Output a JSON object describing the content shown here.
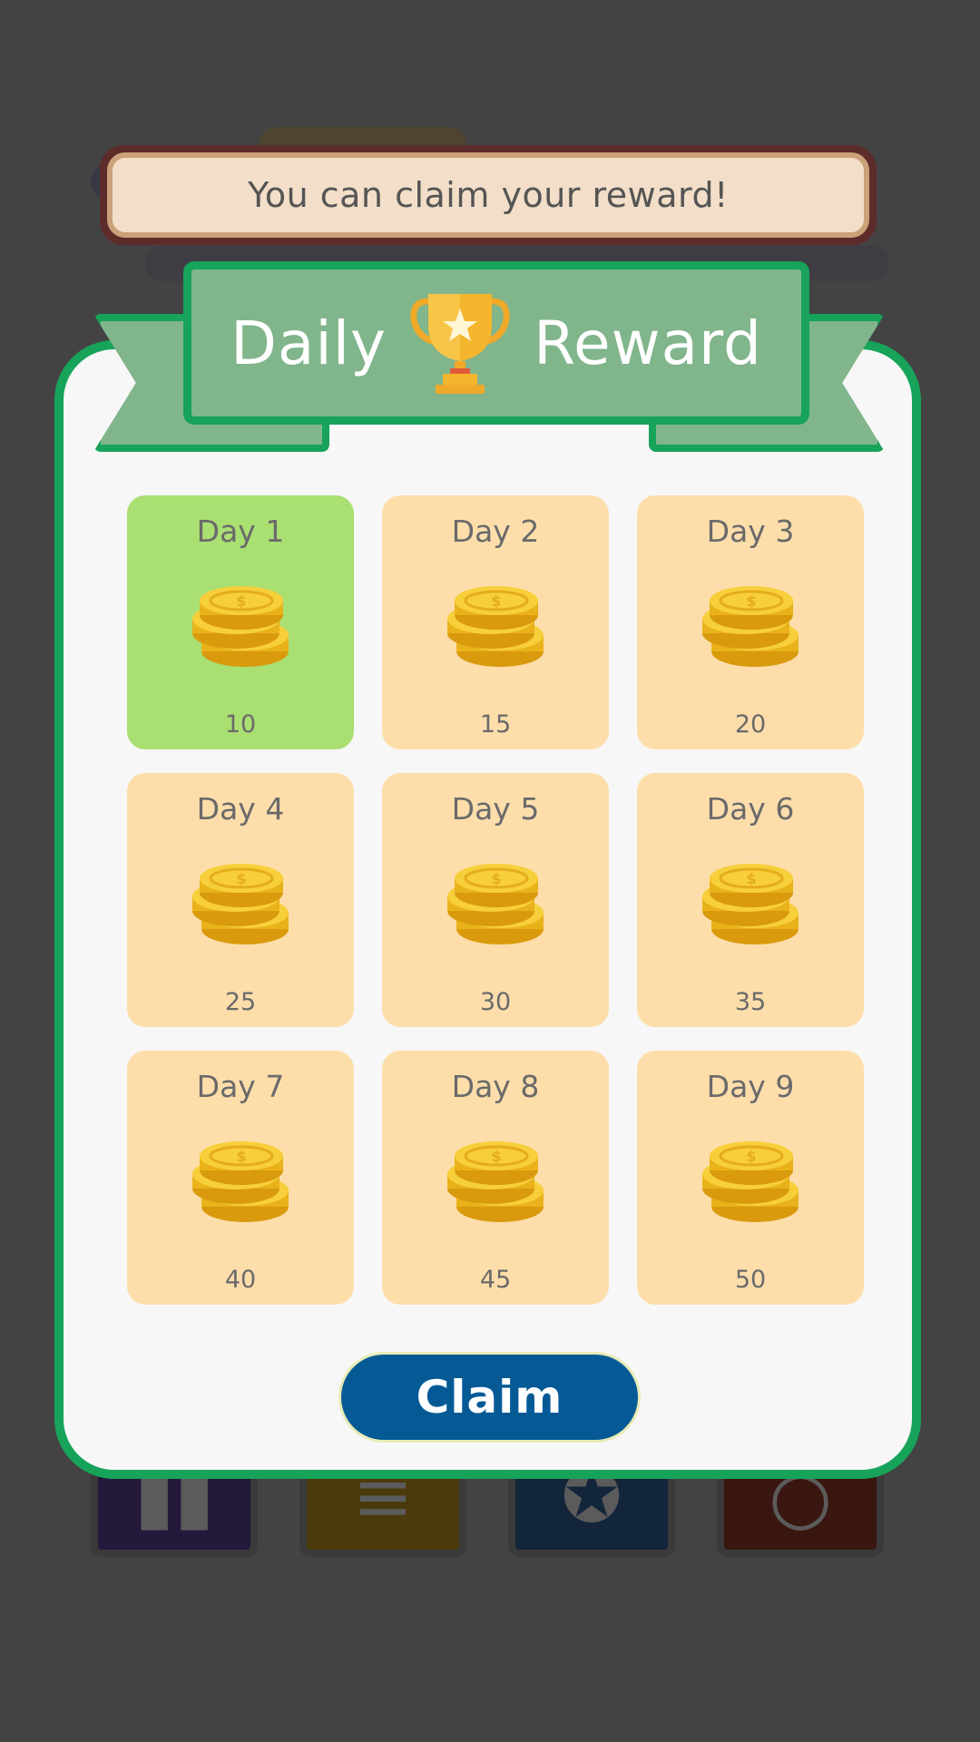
{
  "toast": {
    "message": "You can claim your reward!"
  },
  "header": {
    "title_left": "Daily",
    "title_right": "Reward",
    "icon": "trophy-icon"
  },
  "rewards": [
    {
      "day": "Day 1",
      "amount": "10",
      "state": "claimable"
    },
    {
      "day": "Day 2",
      "amount": "15",
      "state": "locked"
    },
    {
      "day": "Day 3",
      "amount": "20",
      "state": "locked"
    },
    {
      "day": "Day 4",
      "amount": "25",
      "state": "locked"
    },
    {
      "day": "Day 5",
      "amount": "30",
      "state": "locked"
    },
    {
      "day": "Day 6",
      "amount": "35",
      "state": "locked"
    },
    {
      "day": "Day 7",
      "amount": "40",
      "state": "locked"
    },
    {
      "day": "Day 8",
      "amount": "45",
      "state": "locked"
    },
    {
      "day": "Day 9",
      "amount": "50",
      "state": "locked"
    }
  ],
  "claim": {
    "label": "Claim"
  },
  "colors": {
    "panel_border": "#17a35a",
    "ribbon": "#81b58c",
    "card_active": "#aadf72",
    "card_locked": "#fddeab",
    "claim_button": "#055a96",
    "overlay": "#434343"
  }
}
